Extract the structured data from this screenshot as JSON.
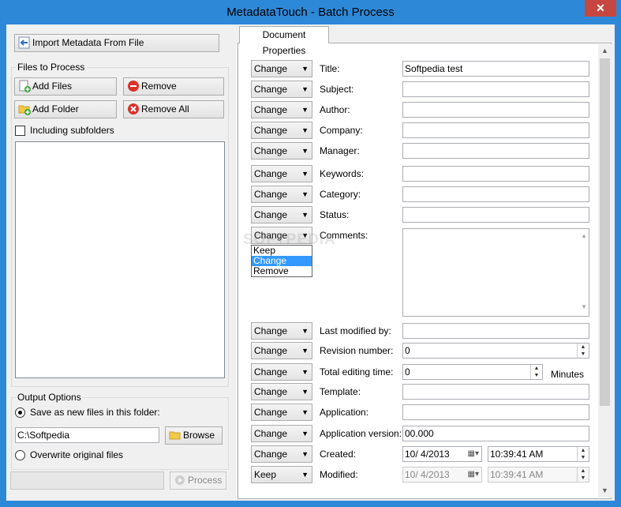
{
  "window": {
    "title": "MetadataTouch - Batch Process",
    "close_glyph": "✕"
  },
  "left": {
    "import_label": "Import Metadata From File",
    "files_group": "Files to Process",
    "add_files": "Add Files",
    "remove": "Remove",
    "add_folder": "Add Folder",
    "remove_all": "Remove All",
    "include_subfolders": "Including subfolders",
    "output_group": "Output Options",
    "save_new": "Save as new files in this folder:",
    "folder_path": "C:\\Softpedia",
    "browse": "Browse",
    "overwrite": "Overwrite original files",
    "process": "Process"
  },
  "tab": {
    "label": "Document Properties"
  },
  "fields": [
    {
      "action": "Change",
      "label": "Title:",
      "value": "Softpedia test"
    },
    {
      "action": "Change",
      "label": "Subject:",
      "value": ""
    },
    {
      "action": "Change",
      "label": "Author:",
      "value": ""
    },
    {
      "action": "Change",
      "label": "Company:",
      "value": ""
    },
    {
      "action": "Change",
      "label": "Manager:",
      "value": ""
    },
    {
      "action": "Change",
      "label": "Keywords:",
      "value": ""
    },
    {
      "action": "Change",
      "label": "Category:",
      "value": ""
    },
    {
      "action": "Change",
      "label": "Status:",
      "value": ""
    },
    {
      "action": "Change",
      "label": "Comments:",
      "value": ""
    },
    {
      "action": "Change",
      "label": "Last modified by:",
      "value": ""
    },
    {
      "action": "Change",
      "label": "Revision number:",
      "value": "0"
    },
    {
      "action": "Change",
      "label": "Total editing time:",
      "value": "0",
      "unit": "Minutes"
    },
    {
      "action": "Change",
      "label": "Template:",
      "value": ""
    },
    {
      "action": "Change",
      "label": "Application:",
      "value": ""
    },
    {
      "action": "Change",
      "label": "Application version:",
      "value": "00.000"
    },
    {
      "action": "Change",
      "label": "Created:",
      "date": "10/ 4/2013",
      "time": "10:39:41 AM"
    },
    {
      "action": "Keep",
      "label": "Modified:",
      "date": "10/ 4/2013",
      "time": "10:39:41 AM"
    }
  ],
  "dropdown": {
    "options": [
      "Keep",
      "Change",
      "Remove"
    ],
    "selected": "Change"
  },
  "watermark": "SOFTPEDIA"
}
